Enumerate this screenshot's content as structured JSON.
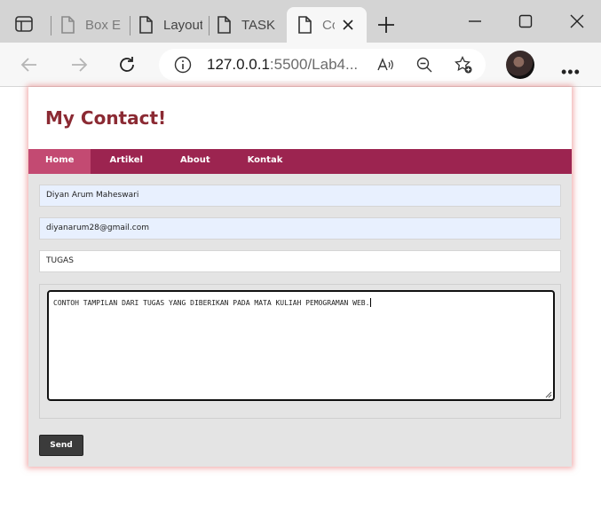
{
  "browser": {
    "tabs": [
      {
        "label": "Box El"
      },
      {
        "label": "Layout"
      },
      {
        "label": "TASK"
      },
      {
        "label": "Co"
      }
    ],
    "url": {
      "host": "127.0.0.1",
      "rest": ":5500/Lab4..."
    }
  },
  "page": {
    "title": "My Contact!",
    "nav": [
      {
        "label": "Home"
      },
      {
        "label": "Artikel"
      },
      {
        "label": "About"
      },
      {
        "label": "Kontak"
      }
    ],
    "form": {
      "name_value": "Diyan Arum Maheswari",
      "email_value": "diyanarum28@gmail.com",
      "subject_value": "TUGAS",
      "message_value": "CONTOH TAMPILAN DARI TUGAS YANG DIBERIKAN PADA MATA KULIAH PEMOGRAMAN WEB.",
      "send_label": "Send"
    }
  },
  "colors": {
    "nav_bg": "#9c2450",
    "nav_active": "#c34a72",
    "title": "#8b2a33",
    "autofill": "#e8f0fe"
  }
}
